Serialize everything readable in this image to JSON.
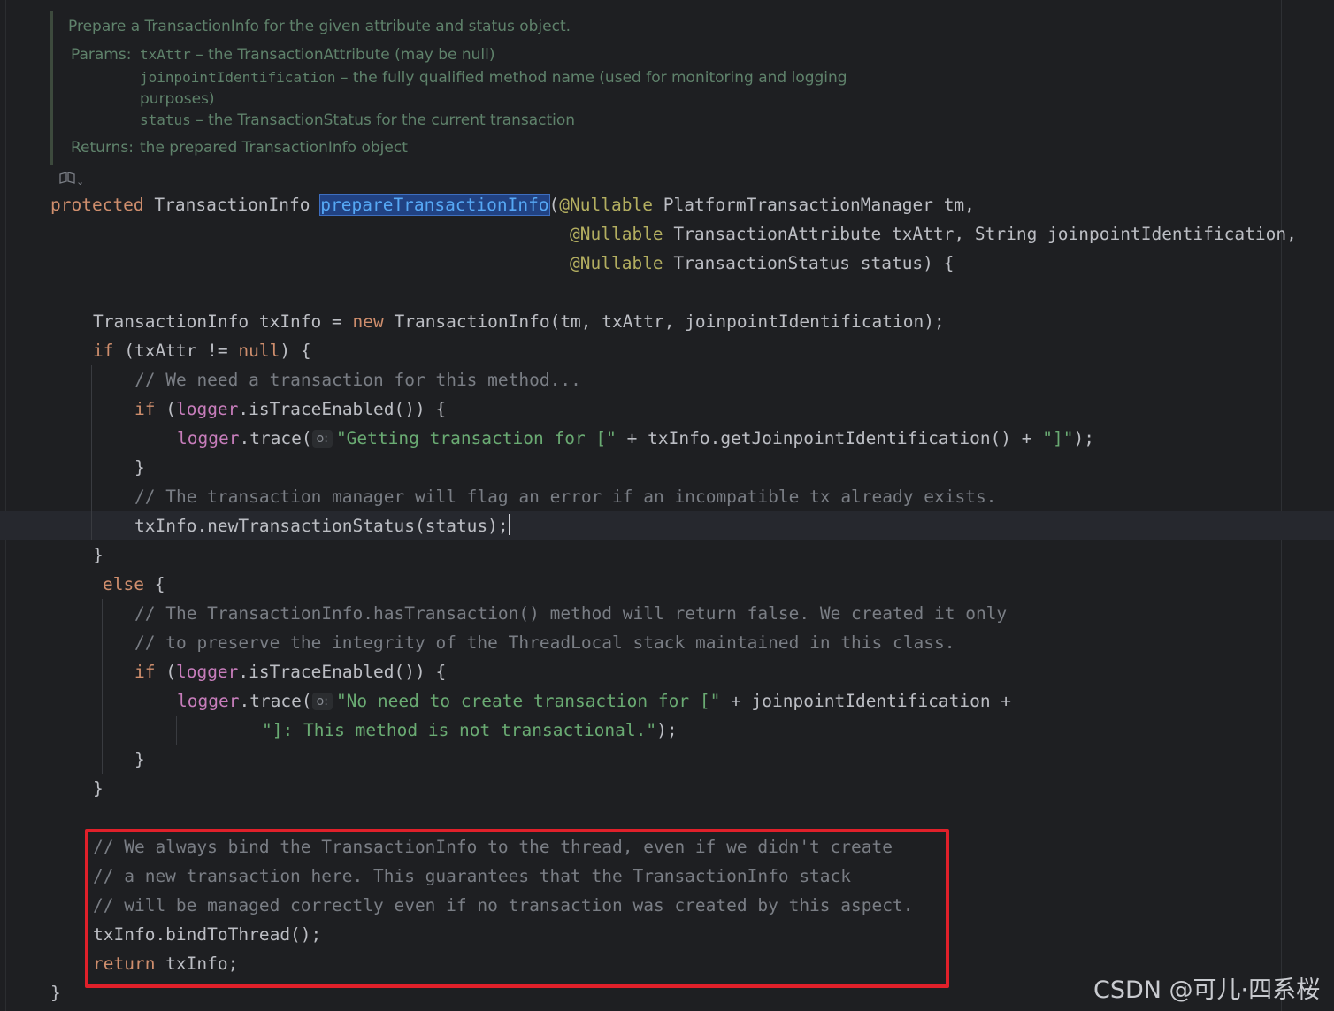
{
  "doc": {
    "summary": "Prepare a TransactionInfo for the given attribute and status object.",
    "params_label": "Params:",
    "params": [
      {
        "name": "txAttr",
        "desc": " – the TransactionAttribute (may be null)"
      },
      {
        "name": "joinpointIdentification",
        "desc": " – the fully qualified method name (used for monitoring and logging"
      },
      {
        "name": "",
        "desc": "purposes)"
      },
      {
        "name": "status",
        "desc": " – the TransactionStatus for the current transaction"
      }
    ],
    "returns_label": "Returns:",
    "returns_text": "the prepared TransactionInfo object",
    "toggle_icon": "reader-mode-icon"
  },
  "code": {
    "sig1_kw": "protected",
    "sig1_type": " TransactionInfo ",
    "method_name": "prepareTransactionInfo",
    "sig1_paren": "(",
    "nullable": "@Nullable",
    "sig1_rest": " PlatformTransactionManager tm,",
    "sig2_rest": " TransactionAttribute txAttr, String joinpointIdentification,",
    "sig3_rest": " TransactionStatus status) {",
    "l4_a": "TransactionInfo txInfo = ",
    "new_kw": "new",
    "l4_b": " TransactionInfo(tm, txAttr, joinpointIdentification);",
    "if_kw": "if",
    "l5_a": " (txAttr != ",
    "null_kw": "null",
    "l5_b": ") {",
    "c1": "// We need a transaction for this method...",
    "l7_a": " (",
    "logger": "logger",
    "l7_b": ".isTraceEnabled()) {",
    "l8_a": ".trace(",
    "hint_o": "o:",
    "str1": "\"Getting transaction for [\"",
    "l8_b": " + txInfo.getJoinpointIdentification() + ",
    "str2": "\"]\"",
    "l8_c": ");",
    "close_brace": "}",
    "c2": "// The transaction manager will flag an error if an incompatible tx already exists.",
    "l11": "txInfo.newTransactionStatus(status);",
    "else_kw": "else",
    "open_brace": " {",
    "c3": "// The TransactionInfo.hasTransaction() method will return false. We created it only",
    "c4": "// to preserve the integrity of the ThreadLocal stack maintained in this class.",
    "str3": "\"No need to create transaction for [\"",
    "l17_b": " + joinpointIdentification +",
    "str4": "\"]: This method is not transactional.\"",
    "c5": "// We always bind the TransactionInfo to the thread, even if we didn't create",
    "c6": "// a new transaction here. This guarantees that the TransactionInfo stack",
    "c7": "// will be managed correctly even if no transaction was created by this aspect.",
    "l25": "txInfo.bindToThread();",
    "return_kw": "return",
    "l26_b": " txInfo;"
  },
  "watermark": "CSDN @可儿·四系桜",
  "colors": {
    "background": "#1e1f22",
    "keyword": "#cf8e6d",
    "annotation": "#b3ae60",
    "string": "#6aab73",
    "comment": "#7a7e85",
    "field": "#c77dbb",
    "highlight_box": "#e0202a"
  }
}
